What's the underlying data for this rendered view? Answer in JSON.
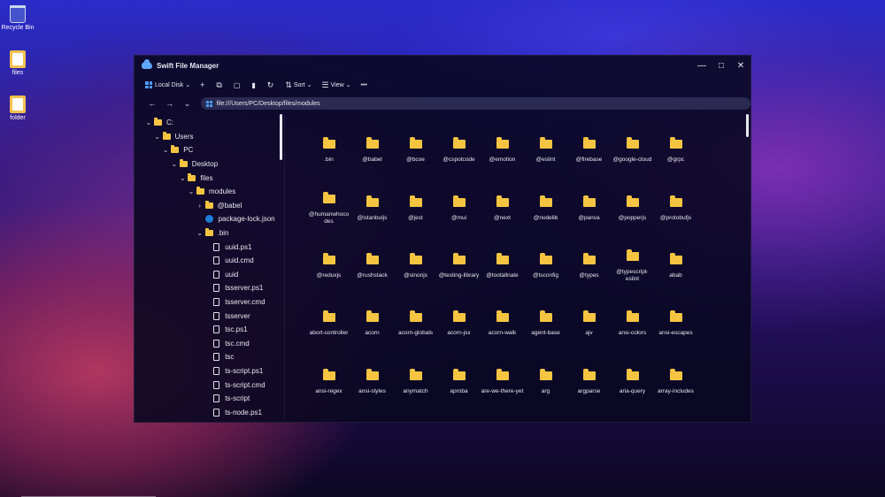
{
  "desktop": {
    "icons": [
      {
        "label": "Recycle Bin"
      },
      {
        "label": "files"
      },
      {
        "label": "folder"
      }
    ]
  },
  "window": {
    "title": "Swift File Manager",
    "controls": {
      "minimize": "—",
      "maximize": "□",
      "close": "✕"
    }
  },
  "toolbar": {
    "drive_label": "Local Disk",
    "new_icon": "+",
    "copy_icon": "⧉",
    "paste_icon": "📋",
    "delete_icon": "🗑",
    "refresh_icon": "↻",
    "sort_label": "Sort",
    "view_label": "View",
    "more_icon": "•••"
  },
  "address": {
    "back": "←",
    "forward": "→",
    "history": "⌄",
    "path": "file:///Users/PC/Desktop/files/modules"
  },
  "tree": [
    {
      "label": "C:",
      "depth": 0,
      "kind": "folder",
      "chev": "⌄"
    },
    {
      "label": "Users",
      "depth": 1,
      "kind": "folder",
      "chev": "⌄"
    },
    {
      "label": "PC",
      "depth": 2,
      "kind": "folder",
      "chev": "⌄"
    },
    {
      "label": "Desktop",
      "depth": 3,
      "kind": "folder",
      "chev": "⌄"
    },
    {
      "label": "files",
      "depth": 4,
      "kind": "folder",
      "chev": "⌄"
    },
    {
      "label": "modules",
      "depth": 5,
      "kind": "folder",
      "chev": "⌄"
    },
    {
      "label": "@babel",
      "depth": 6,
      "kind": "folder",
      "chev": "›"
    },
    {
      "label": "package-lock.json",
      "depth": 6,
      "kind": "pkg",
      "chev": ""
    },
    {
      "label": ".bin",
      "depth": 6,
      "kind": "folder",
      "chev": "⌄"
    },
    {
      "label": "uuid.ps1",
      "depth": 7,
      "kind": "file",
      "chev": ""
    },
    {
      "label": "uuid.cmd",
      "depth": 7,
      "kind": "file",
      "chev": ""
    },
    {
      "label": "uuid",
      "depth": 7,
      "kind": "file",
      "chev": ""
    },
    {
      "label": "tsserver.ps1",
      "depth": 7,
      "kind": "file",
      "chev": ""
    },
    {
      "label": "tsserver.cmd",
      "depth": 7,
      "kind": "file",
      "chev": ""
    },
    {
      "label": "tsserver",
      "depth": 7,
      "kind": "file",
      "chev": ""
    },
    {
      "label": "tsc.ps1",
      "depth": 7,
      "kind": "file",
      "chev": ""
    },
    {
      "label": "tsc.cmd",
      "depth": 7,
      "kind": "file",
      "chev": ""
    },
    {
      "label": "tsc",
      "depth": 7,
      "kind": "file",
      "chev": ""
    },
    {
      "label": "ts-script.ps1",
      "depth": 7,
      "kind": "file",
      "chev": ""
    },
    {
      "label": "ts-script.cmd",
      "depth": 7,
      "kind": "file",
      "chev": ""
    },
    {
      "label": "ts-script",
      "depth": 7,
      "kind": "file",
      "chev": ""
    },
    {
      "label": "ts-node.ps1",
      "depth": 7,
      "kind": "file",
      "chev": ""
    }
  ],
  "grid": [
    ".bin",
    "@babel",
    "@bcoe",
    "@cspotcode",
    "@emotion",
    "@eslint",
    "@firebase",
    "@google-cloud",
    "@grpc",
    "@humanwhocodes",
    "@istanbuljs",
    "@jest",
    "@mui",
    "@next",
    "@nodelib",
    "@panva",
    "@popperjs",
    "@protobufjs",
    "@reduxjs",
    "@rushstack",
    "@sinonjs",
    "@testing-library",
    "@tootallnate",
    "@tsconfig",
    "@types",
    "@typescript-eslint",
    "abab",
    "abort-controller",
    "acorn",
    "acorn-globals",
    "acorn-jsx",
    "acorn-walk",
    "agent-base",
    "ajv",
    "ansi-colors",
    "ansi-escapes",
    "ansi-regex",
    "ansi-styles",
    "anymatch",
    "aproba",
    "are-we-there-yet",
    "arg",
    "argparse",
    "aria-query",
    "array-includes",
    "",
    "",
    "",
    "",
    "",
    "",
    "",
    "",
    ""
  ]
}
